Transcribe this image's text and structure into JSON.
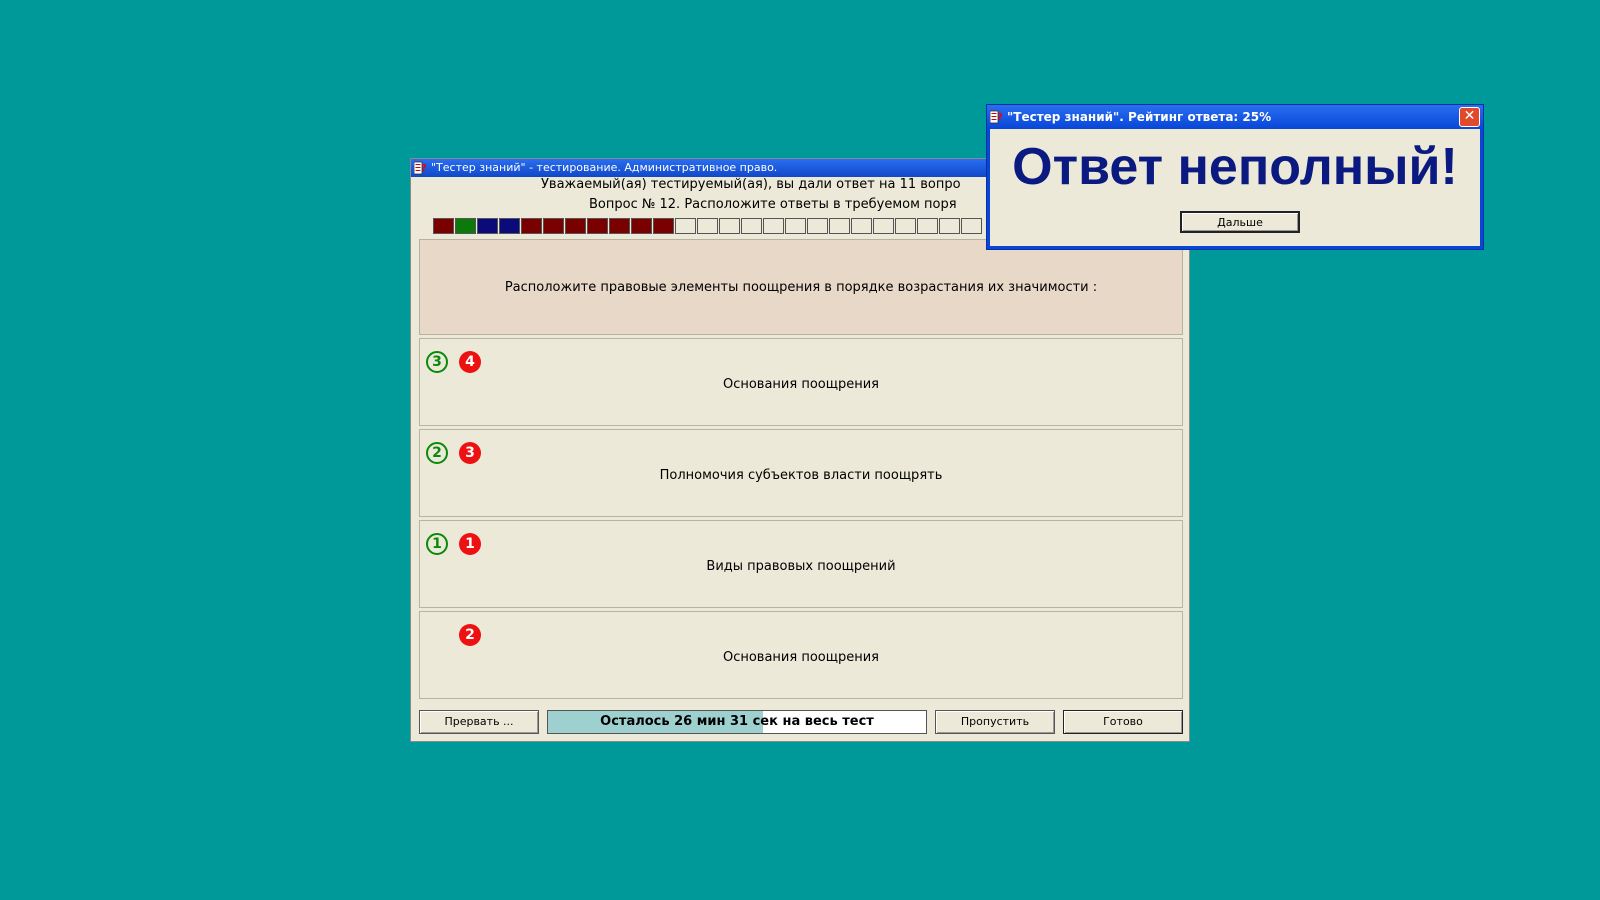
{
  "main_window": {
    "title": "\"Тестер знаний\" - тестирование. Административное право.",
    "header_line1": "Уважаемый(ая) тестируемый(ая), вы дали ответ на 11 вопро",
    "header_line2": "Вопрос № 12. Расположите ответы в требуемом поря",
    "progress_cells": [
      "#7a0000",
      "#0b7a0b",
      "#0a0a7a",
      "#0a0a7a",
      "#7a0000",
      "#7a0000",
      "#7a0000",
      "#7a0000",
      "#7a0000",
      "#7a0000",
      "#7a0000",
      "#ECE9D8",
      "#ECE9D8",
      "#ECE9D8",
      "#ECE9D8",
      "#ECE9D8",
      "#ECE9D8",
      "#ECE9D8",
      "#ECE9D8",
      "#ECE9D8",
      "#ECE9D8",
      "#ECE9D8",
      "#ECE9D8",
      "#ECE9D8",
      "#ECE9D8"
    ],
    "question_text": "Расположите правовые элементы поощрения в порядке возрастания их значимости :",
    "answers": [
      {
        "text": "Основания поощрения",
        "correct": "3",
        "given": "4"
      },
      {
        "text": "Полномочия субъектов власти поощрять",
        "correct": "2",
        "given": "3"
      },
      {
        "text": "Виды правовых поощрений",
        "correct": "1",
        "given": "1"
      },
      {
        "text": "Основания поощрения",
        "correct": "",
        "given": "2"
      }
    ],
    "buttons": {
      "abort": "Прервать ...",
      "skip": "Пропустить",
      "done": "Готово"
    },
    "timer": {
      "text": "Осталось 26 мин 31 сек на весь тест",
      "fraction": 0.57
    }
  },
  "dialog": {
    "title": "\"Тестер знаний\". Рейтинг ответа: 25%",
    "message": "Ответ неполный!",
    "next_button": "Дальше",
    "close_glyph": "✕"
  },
  "colors": {
    "desktop": "#009999",
    "window_face": "#ECE9D8",
    "title_blue": "#0846d8",
    "correct_green": "#0a8a0a",
    "given_red": "#ee1111",
    "message_navy": "#0a1a80"
  }
}
